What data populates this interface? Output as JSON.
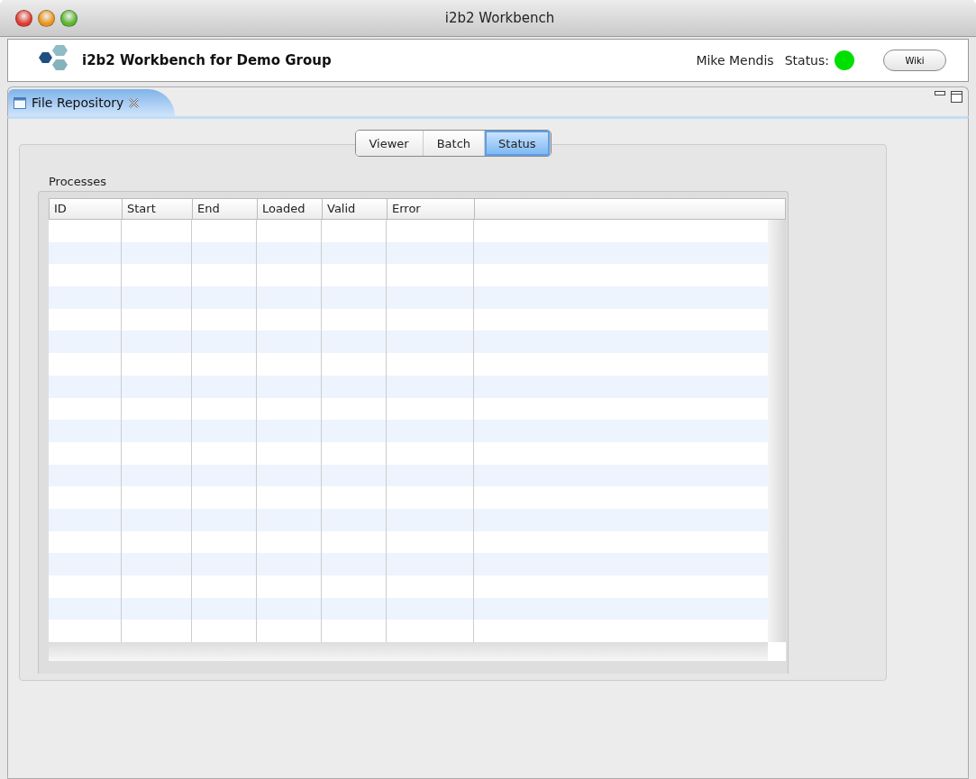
{
  "window": {
    "title": "i2b2 Workbench"
  },
  "header": {
    "title": "i2b2 Workbench for Demo Group",
    "user": "Mike Mendis",
    "status_label": "Status:",
    "status_online": true,
    "wiki_button": "Wiki"
  },
  "view_tab": {
    "label": "File Repository"
  },
  "segments": [
    {
      "label": "Viewer",
      "selected": false
    },
    {
      "label": "Batch",
      "selected": false
    },
    {
      "label": "Status",
      "selected": true
    }
  ],
  "processes": {
    "title": "Processes",
    "columns": [
      "ID",
      "Start",
      "End",
      "Loaded",
      "Valid",
      "Error"
    ]
  }
}
